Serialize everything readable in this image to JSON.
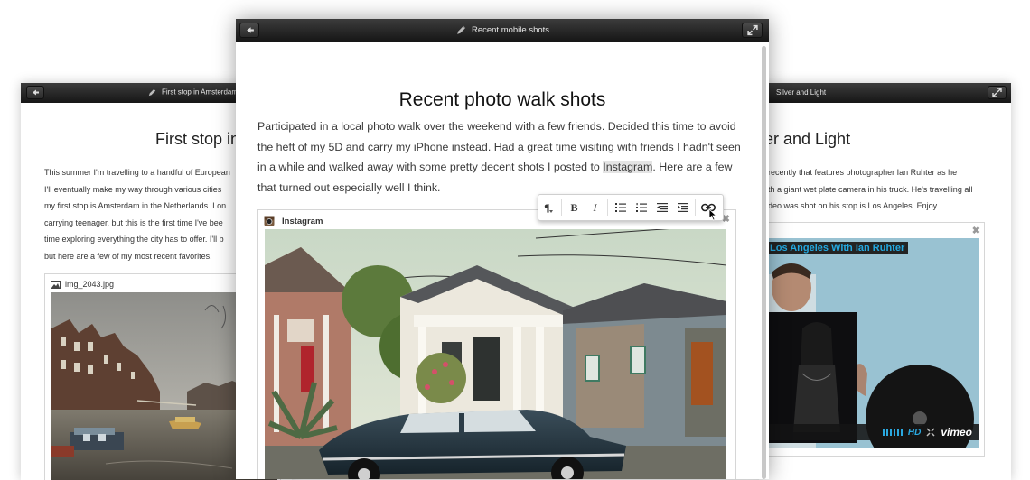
{
  "left_window": {
    "title": "First stop in Amsterdam",
    "heading": "First stop in",
    "paragraph_lines": [
      "This summer I'm travelling to a handful of European",
      "I'll eventually make my way through various cities",
      "my first stop is Amsterdam in the Netherlands. I on",
      "carrying teenager, but this is the first time I've bee",
      "time exploring everything the city has to offer. I'll b",
      "but here are a few of my most recent favorites."
    ],
    "attachment_name": "img_2043.jpg"
  },
  "main_window": {
    "title": "Recent mobile shots",
    "heading": "Recent photo walk shots",
    "paragraph": {
      "before": "Participated in a local photo walk over the weekend with a few friends. Decided this time to avoid the heft of my 5D and carry my iPhone instead. Had a great time visiting with friends I hadn't seen in a while and walked away with some pretty decent shots I posted to ",
      "selected": "Instagram",
      "after": ". Here are a few that turned out especially well I think."
    },
    "embed": {
      "source": "Instagram"
    },
    "toolbar": {
      "paragraph_symbol": "¶",
      "bold": "B",
      "italic": "I"
    }
  },
  "right_window": {
    "title": "Silver and Light",
    "heading": "er and Light",
    "paragraph_lines": [
      "recently that features photographer Ian Ruhter as he",
      "th a giant wet plate camera in his truck. He's travelling all",
      "deo was shot on his stop is Los Angeles. Enjoy."
    ],
    "video": {
      "caption": "Los Angeles With Ian Ruhter",
      "quality": "HD",
      "brand": "vimeo"
    }
  },
  "colors": {
    "titlebar": "#1e1e1e",
    "video_caption_bg": "#232323",
    "video_caption_text": "#24a8e0",
    "selection": "#e4e4e4"
  }
}
